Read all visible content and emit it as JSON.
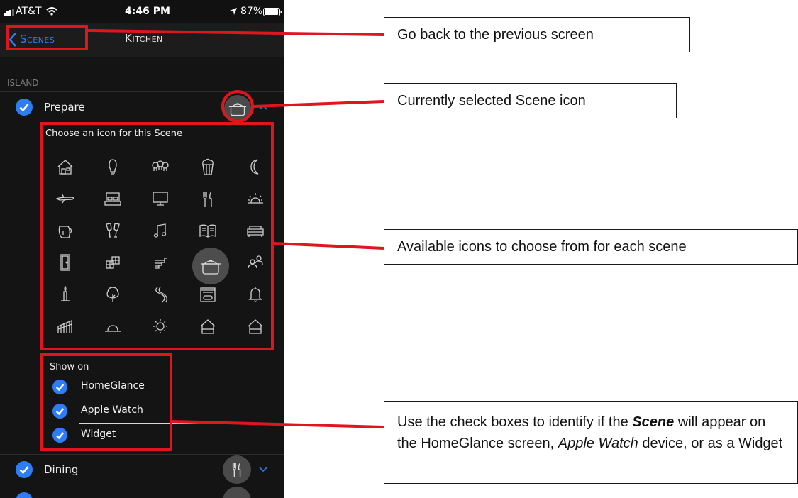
{
  "status_bar": {
    "carrier": "AT&T",
    "time": "4:46 PM",
    "battery": "87%"
  },
  "nav": {
    "back_label": "Scenes",
    "title": "Kitchen"
  },
  "section_header": "ISLAND",
  "scenes": [
    {
      "label": "Prepare",
      "checked": true,
      "icon": "pot-icon",
      "expanded": true
    },
    {
      "label": "Dining",
      "checked": true,
      "icon": "fork-knife-icon",
      "expanded": false
    }
  ],
  "icon_picker": {
    "prompt": "Choose an icon for this Scene",
    "rows": [
      [
        "house-icon",
        "lightbulb-icon",
        "bulbs-icon",
        "popcorn-icon",
        "moon-icon"
      ],
      [
        "airplane-icon",
        "bed-icon",
        "monitor-icon",
        "fork-knife-icon",
        "sunrise-icon"
      ],
      [
        "coffee-pot-icon",
        "cheers-icon",
        "music-note-icon",
        "book-icon",
        "sofa-icon"
      ],
      [
        "door-icon",
        "blocks-icon",
        "stairs-icon",
        "pot-icon",
        "people-icon"
      ],
      [
        "candle-icon",
        "tree-icon",
        "path-icon",
        "garage-icon",
        "bell-icon"
      ],
      [
        "fence-icon",
        "horizon-icon",
        "sun-icon",
        "home-outline-icon",
        "home-outline-icon"
      ]
    ],
    "selected": "pot-icon"
  },
  "show_on": {
    "label": "Show on",
    "options": [
      {
        "label": "HomeGlance",
        "checked": true
      },
      {
        "label": "Apple Watch",
        "checked": true
      },
      {
        "label": "Widget",
        "checked": true
      }
    ]
  },
  "annotations": {
    "back": "Go back to the previous screen",
    "selected_icon": "Currently selected Scene icon",
    "available": "Available icons to choose from for each scene",
    "checkbox_pre": "Use the check boxes to identify if the ",
    "checkbox_scene": "Scene",
    "checkbox_mid": " will appear on the HomeGlance screen, ",
    "checkbox_watch": "Apple Watch",
    "checkbox_post": " device, or as a Widget"
  },
  "colors": {
    "accent": "#2e7cf6",
    "callout": "#e0161f",
    "background": "#141414"
  }
}
